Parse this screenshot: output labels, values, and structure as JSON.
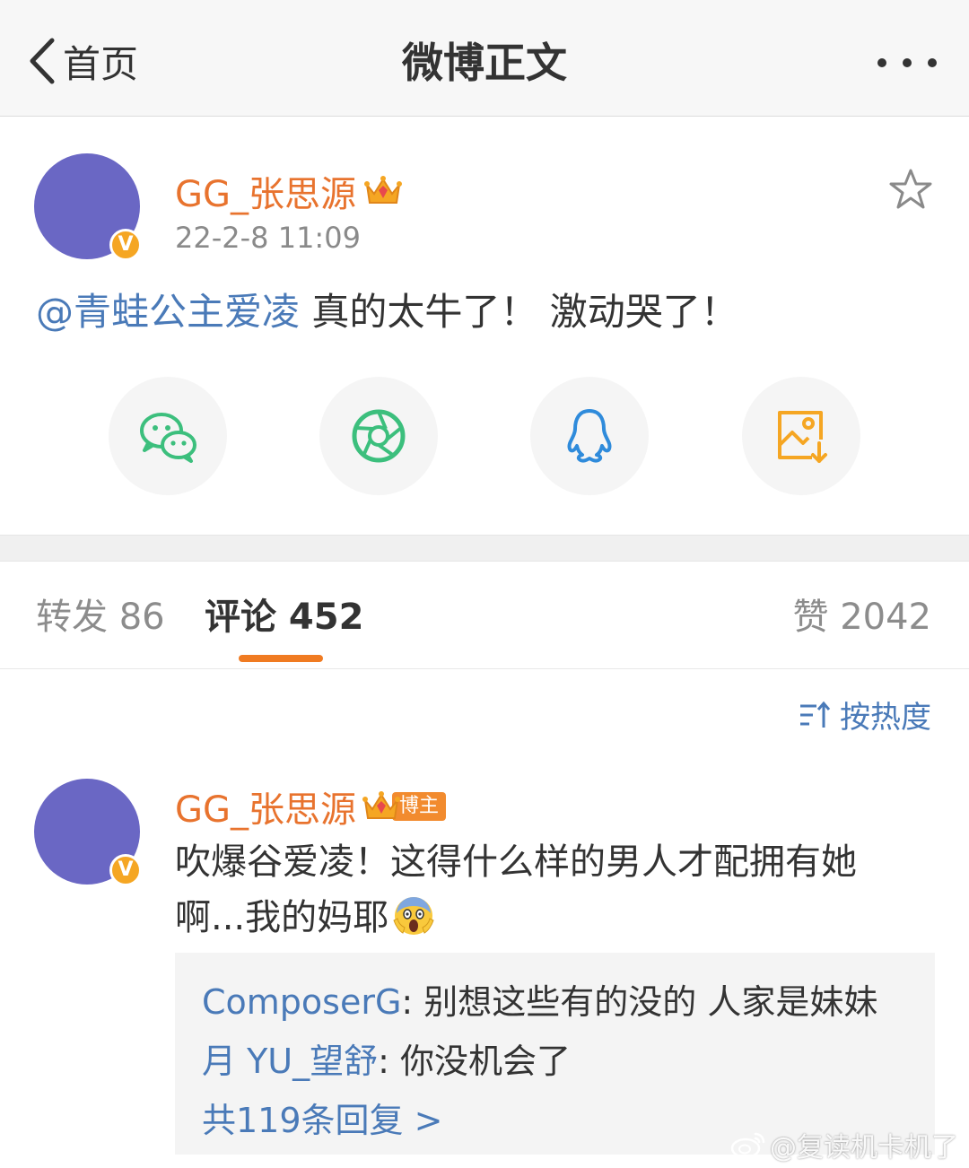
{
  "nav": {
    "back_label": "首页",
    "title": "微博正文"
  },
  "post": {
    "username": "GG_张思源",
    "time": "22-2-8 11:09",
    "mention": "@青蛙公主爱凌",
    "text": " 真的太牛了！ 激动哭了！"
  },
  "verified_mark": "V",
  "share": [
    {
      "name": "wechat-share-button",
      "icon": "wechat-icon",
      "color": "#3cbf7d"
    },
    {
      "name": "moments-share-button",
      "icon": "moments-aperture-icon",
      "color": "#3cbf7d"
    },
    {
      "name": "qq-share-button",
      "icon": "qq-penguin-icon",
      "color": "#2f8bdb"
    },
    {
      "name": "save-image-button",
      "icon": "save-image-icon",
      "color": "#f5a623"
    }
  ],
  "tabs": {
    "repost": "转发 86",
    "comments": "评论 452",
    "likes": "赞 2042"
  },
  "sort_label": "按热度",
  "comment": {
    "username": "GG_张思源",
    "author_badge": "博主",
    "text": "吹爆谷爱凌！这得什么样的男人才配拥有她啊...我的妈耶"
  },
  "replies": [
    {
      "user": "ComposerG",
      "text": ": 别想这些有的没的 人家是妹妹"
    },
    {
      "user": "月 YU_望舒",
      "text": ": 你没机会了"
    }
  ],
  "replies_more": "共119条回复 >",
  "watermark": "@复读机卡机了",
  "colors": {
    "accent": "#f07b22",
    "link": "#4a7ab8",
    "username": "#e8732e",
    "avatar": "#6a67c4"
  }
}
